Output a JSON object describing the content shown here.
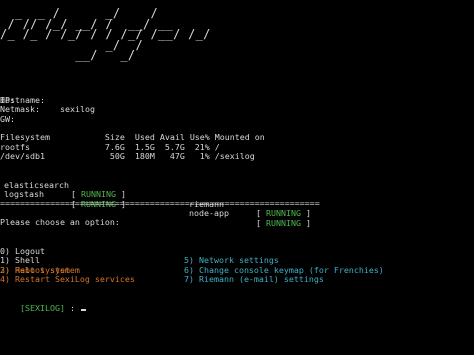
{
  "logo_art": "  _  _ /      _/    /\n / // /_/ __/ /  __/ __ \n/_ /_ / /_/ / / /_/ /__/ /_/\n              _/  /\n          __/   _/\n",
  "info": {
    "hostname_label": "Hostname:",
    "hostname_value": "sexilog",
    "ip_label": "IP:",
    "netmask_label": "Netmask:",
    "gw_label": "GW:"
  },
  "filesystem": {
    "header": "Filesystem           Size  Used Avail Use% Mounted on",
    "rows": [
      "rootfs               7.6G  1.5G  5.7G  21% /",
      "/dev/sdb1             50G  180M   47G   1% /sexilog"
    ]
  },
  "services": [
    {
      "name": "elasticsearch",
      "open": "[",
      "status": "RUNNING",
      "close": "]"
    },
    {
      "name": "riemann",
      "open": "[",
      "status": "RUNNING",
      "close": "]"
    },
    {
      "name": "logstash",
      "open": "[",
      "status": "RUNNING",
      "close": "]"
    },
    {
      "name": "node-app",
      "open": "[",
      "status": "RUNNING",
      "close": "]"
    }
  ],
  "separator": "================================================================",
  "prompt_heading": "Please choose an option:",
  "menu": {
    "left": [
      "0) Logout",
      "1) Shell",
      "2) Reboot system",
      "3) Halt system",
      "4) Restart SexiLog services"
    ],
    "right": [
      "5) Network settings",
      "6) Change console keymap (for Frenchies)",
      "7) Riemann (e-mail) settings"
    ]
  },
  "command_prompt": {
    "tag": "[SEXILOG]",
    "suffix": " : "
  },
  "colors": {
    "running": "#4eb84e",
    "danger_option": "#d2752a",
    "config_option": "#3fb1c6",
    "prompt_tag": "#4eb84e",
    "text": "#d8d8d8",
    "background": "#000000"
  }
}
